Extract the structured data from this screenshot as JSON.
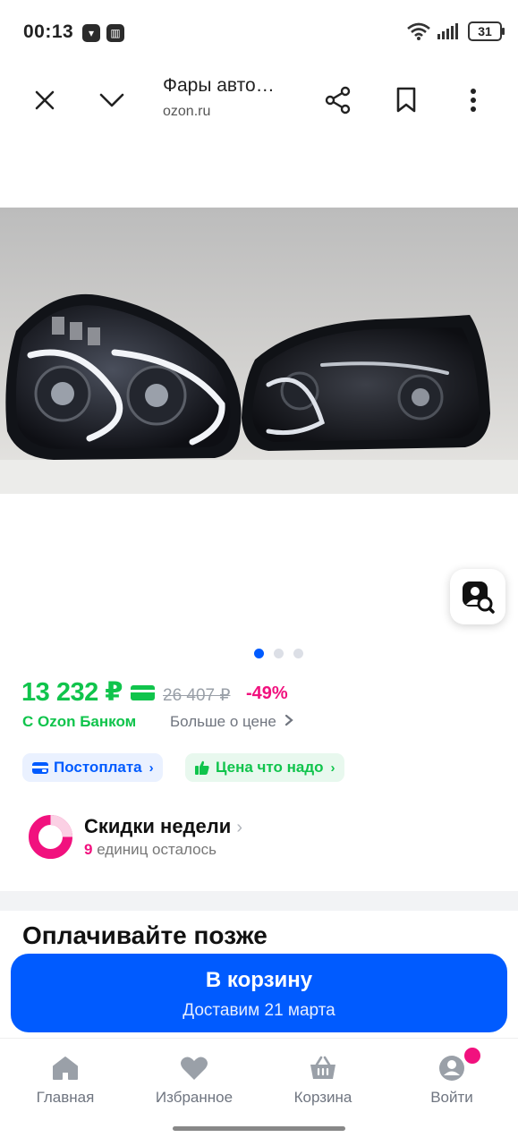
{
  "status_bar": {
    "time": "00:13",
    "battery": "31"
  },
  "browser": {
    "title": "Фары авто…",
    "url": "ozon.ru"
  },
  "gallery": {
    "image_count": 3,
    "active_index": 0
  },
  "price": {
    "current": "13 232 ₽",
    "old": "26 407 ₽",
    "discount": "-49%",
    "bank_label": "С Ozon Банком",
    "more_link": "Больше о цене",
    "colors": {
      "green": "#10c44c",
      "pink": "#f1117e",
      "blue": "#005bff"
    }
  },
  "chips": [
    {
      "label": "Постоплата",
      "icon": "wallet-icon"
    },
    {
      "label": "Цена что надо",
      "icon": "thumbs-up-icon"
    }
  ],
  "deals": {
    "title": "Скидки недели",
    "count": "9",
    "remaining": "единиц осталось"
  },
  "section": {
    "pay_later_title": "Оплачивайте позже"
  },
  "cta": {
    "label": "В корзину",
    "delivery": "Доставим 21 марта"
  },
  "nav": [
    {
      "label": "Главная",
      "icon": "home-icon"
    },
    {
      "label": "Избранное",
      "icon": "heart-icon"
    },
    {
      "label": "Корзина",
      "icon": "basket-icon"
    },
    {
      "label": "Войти",
      "icon": "user-icon"
    }
  ]
}
